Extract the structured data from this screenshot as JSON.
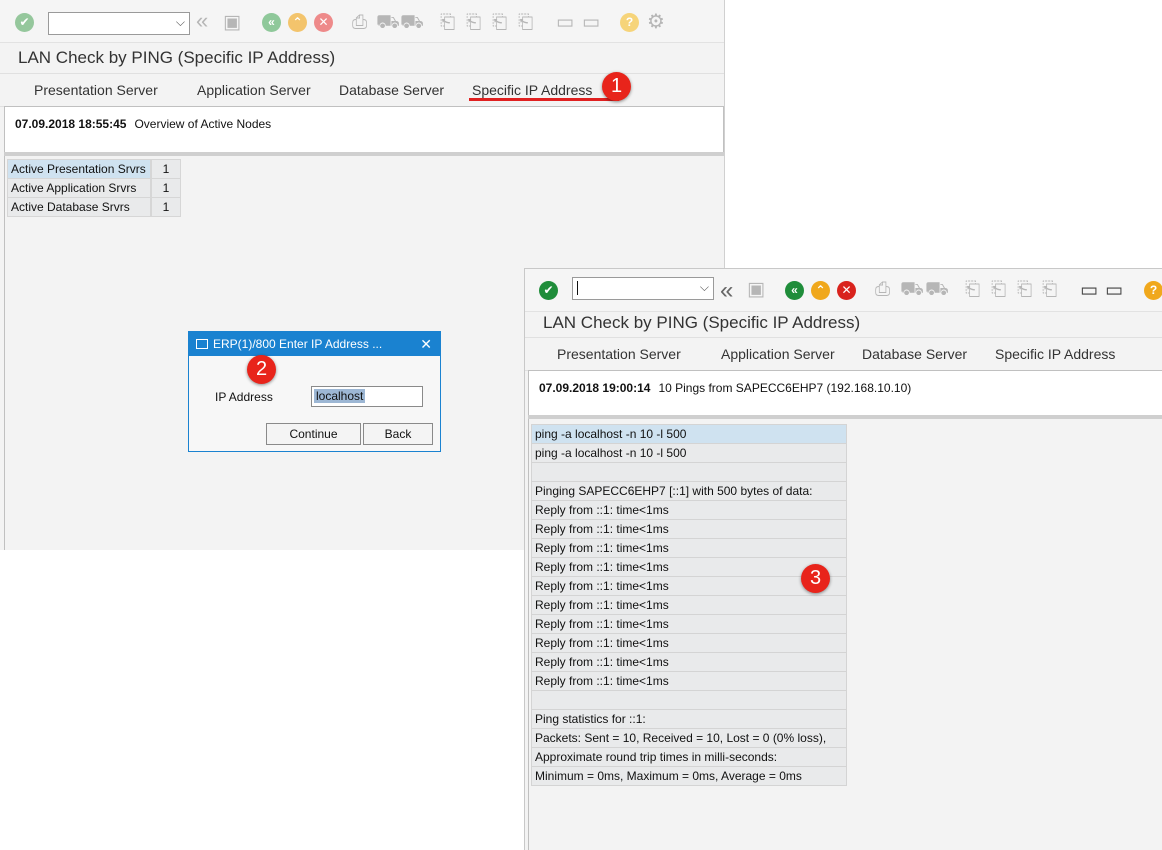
{
  "window1": {
    "title": "LAN Check by PING (Specific IP Address)",
    "tabs": [
      "Presentation Server",
      "Application Server",
      "Database Server",
      "Specific IP Address"
    ],
    "timestamp": "07.09.2018 18:55:45",
    "header_text": "Overview of Active Nodes",
    "nodes": [
      {
        "label": "Active Presentation Srvrs",
        "value": "1"
      },
      {
        "label": "Active Application Srvrs",
        "value": "1"
      },
      {
        "label": "Active Database Srvrs",
        "value": "1"
      }
    ]
  },
  "dialog": {
    "title": "ERP(1)/800 Enter IP Address ...",
    "field_label": "IP Address",
    "field_value": "localhost",
    "continue_label": "Continue",
    "back_label": "Back",
    "close_glyph": "✕"
  },
  "window2": {
    "title": "LAN Check by PING (Specific IP Address)",
    "tabs": [
      "Presentation Server",
      "Application Server",
      "Database Server",
      "Specific IP Address"
    ],
    "timestamp": "07.09.2018 19:00:14",
    "header_text": "10 Pings from  SAPECC6EHP7 (192.168.10.10)",
    "output_lines": [
      "ping -a localhost  -n 10 -l 500",
      "ping -a localhost  -n 10 -l 500",
      "",
      "Pinging SAPECC6EHP7 [::1] with 500 bytes of data:",
      "Reply from ::1: time<1ms",
      "Reply from ::1: time<1ms",
      "Reply from ::1: time<1ms",
      "Reply from ::1: time<1ms",
      "Reply from ::1: time<1ms",
      "Reply from ::1: time<1ms",
      "Reply from ::1: time<1ms",
      "Reply from ::1: time<1ms",
      "Reply from ::1: time<1ms",
      "Reply from ::1: time<1ms",
      "",
      "Ping statistics for ::1:",
      "Packets: Sent = 10, Received = 10, Lost = 0 (0% loss),",
      "Approximate round trip times in milli-seconds:",
      "Minimum = 0ms, Maximum = 0ms, Average = 0ms"
    ]
  },
  "annotations": {
    "badge1": "1",
    "badge2": "2",
    "badge3": "3"
  },
  "icons": {
    "check": "✔",
    "dropdown": "⌵",
    "back_double": "«",
    "save": "▣",
    "nav_back": "«",
    "nav_up": "⌃",
    "cancel": "✕",
    "print": "⎙",
    "find": "⛟",
    "find_next": "⛟",
    "page": "⎗",
    "layout": "▭",
    "help": "?",
    "settings": "⚙"
  },
  "colors": {
    "accent": "#1a82d0",
    "badge": "#e8241b",
    "tab_underline": "#e02020",
    "selected_row": "#cfe2f0"
  }
}
